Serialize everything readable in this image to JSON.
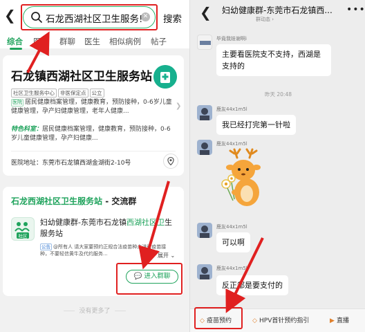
{
  "left": {
    "search": {
      "query": "石龙西湖社区卫生服务!",
      "button_label": "搜索"
    },
    "tabs": [
      "综合",
      "医院",
      "群聊",
      "医生",
      "相似病例",
      "帖子"
    ],
    "card1": {
      "title": "石龙镇西湖社区卫生服务站",
      "tags": [
        "社区卫生服务中心",
        "非医保定点",
        "公立"
      ],
      "service_badge": "医院",
      "services": "居民健康档案管理，健康教育，预防接种，0-6岁儿童健康管理，孕产妇健康管理，老年人健康...",
      "feature_label": "特色科室：",
      "features": "居民健康档案管理，健康教育，预防接种，0-6岁儿童健康管理，孕产妇健康...",
      "address": "医院地址：东莞市石龙镇西湖金湖街2-10号"
    },
    "card2": {
      "title_green": "石龙西湖社区卫生服务站",
      "title_suffix": " - 交流群",
      "logo_text": "社区",
      "group_prefix": "妇幼健康群-东莞市石龙镇",
      "group_green": "西湖社区卫",
      "group_suffix": "生服务站",
      "notice_badge": "公告",
      "notice": "@所有人 请大家要预约正规合法疫苗种点进行疫苗接种，不要轻信黄牛及代约服务...",
      "expand": "展开",
      "join_button": "进入群聊"
    },
    "no_more": "没有更多了"
  },
  "right": {
    "title": "妇幼健康群-东莞市石龙镇西...",
    "subtitle": "群动态",
    "messages": [
      {
        "sender": "毕竟我娃谢啊i",
        "text": "主要看医院支不支持，西湖是支持的"
      },
      {
        "timestamp": "昨天 20:48"
      },
      {
        "sender": "鹿友44x1m5l",
        "text": "我已经打完第一针啦"
      },
      {
        "sender": "鹿友44x1m5l",
        "sticker": "deer-sticker"
      },
      {
        "sender": "鹿友44x1m5l",
        "text": "可以啊"
      },
      {
        "sender": "鹿友44x1m5l",
        "text": "反正都是要支付的"
      }
    ],
    "quick_actions": [
      "疫苗预约",
      "HPV首针预约指引",
      "直播"
    ]
  },
  "colors": {
    "brand_green": "#1fa35c",
    "annotation_red": "#e02020"
  }
}
